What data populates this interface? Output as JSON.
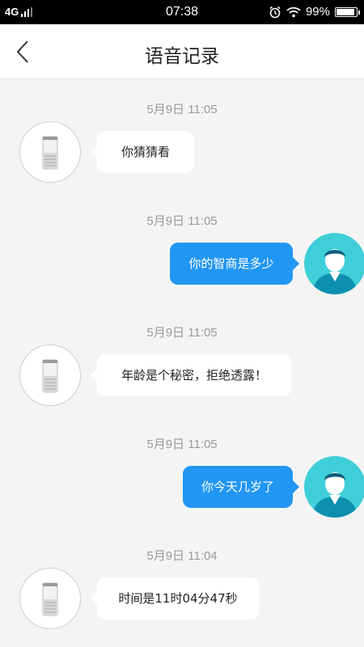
{
  "status_bar": {
    "network": "4G",
    "time": "07:38",
    "battery": "99%",
    "battery_level": 0.99,
    "icons": [
      "signal-icon",
      "alarm-icon",
      "wifi-icon",
      "battery-icon"
    ]
  },
  "header": {
    "title": "语音记录",
    "back_icon": "chevron-left-icon"
  },
  "colors": {
    "accent": "#2196f3",
    "user_avatar": "#3fcfd8",
    "background": "#f4f4f4"
  },
  "messages": [
    {
      "time": "5月9日 11:05",
      "sender": "device",
      "text": "你猜猜看"
    },
    {
      "time": "5月9日 11:05",
      "sender": "user",
      "text": "你的智商是多少"
    },
    {
      "time": "5月9日 11:05",
      "sender": "device",
      "text": "年龄是个秘密，拒绝透露！"
    },
    {
      "time": "5月9日 11:05",
      "sender": "user",
      "text": "你今天几岁了"
    },
    {
      "time": "5月9日 11:04",
      "sender": "device",
      "text": "时间是11时04分47秒"
    }
  ]
}
